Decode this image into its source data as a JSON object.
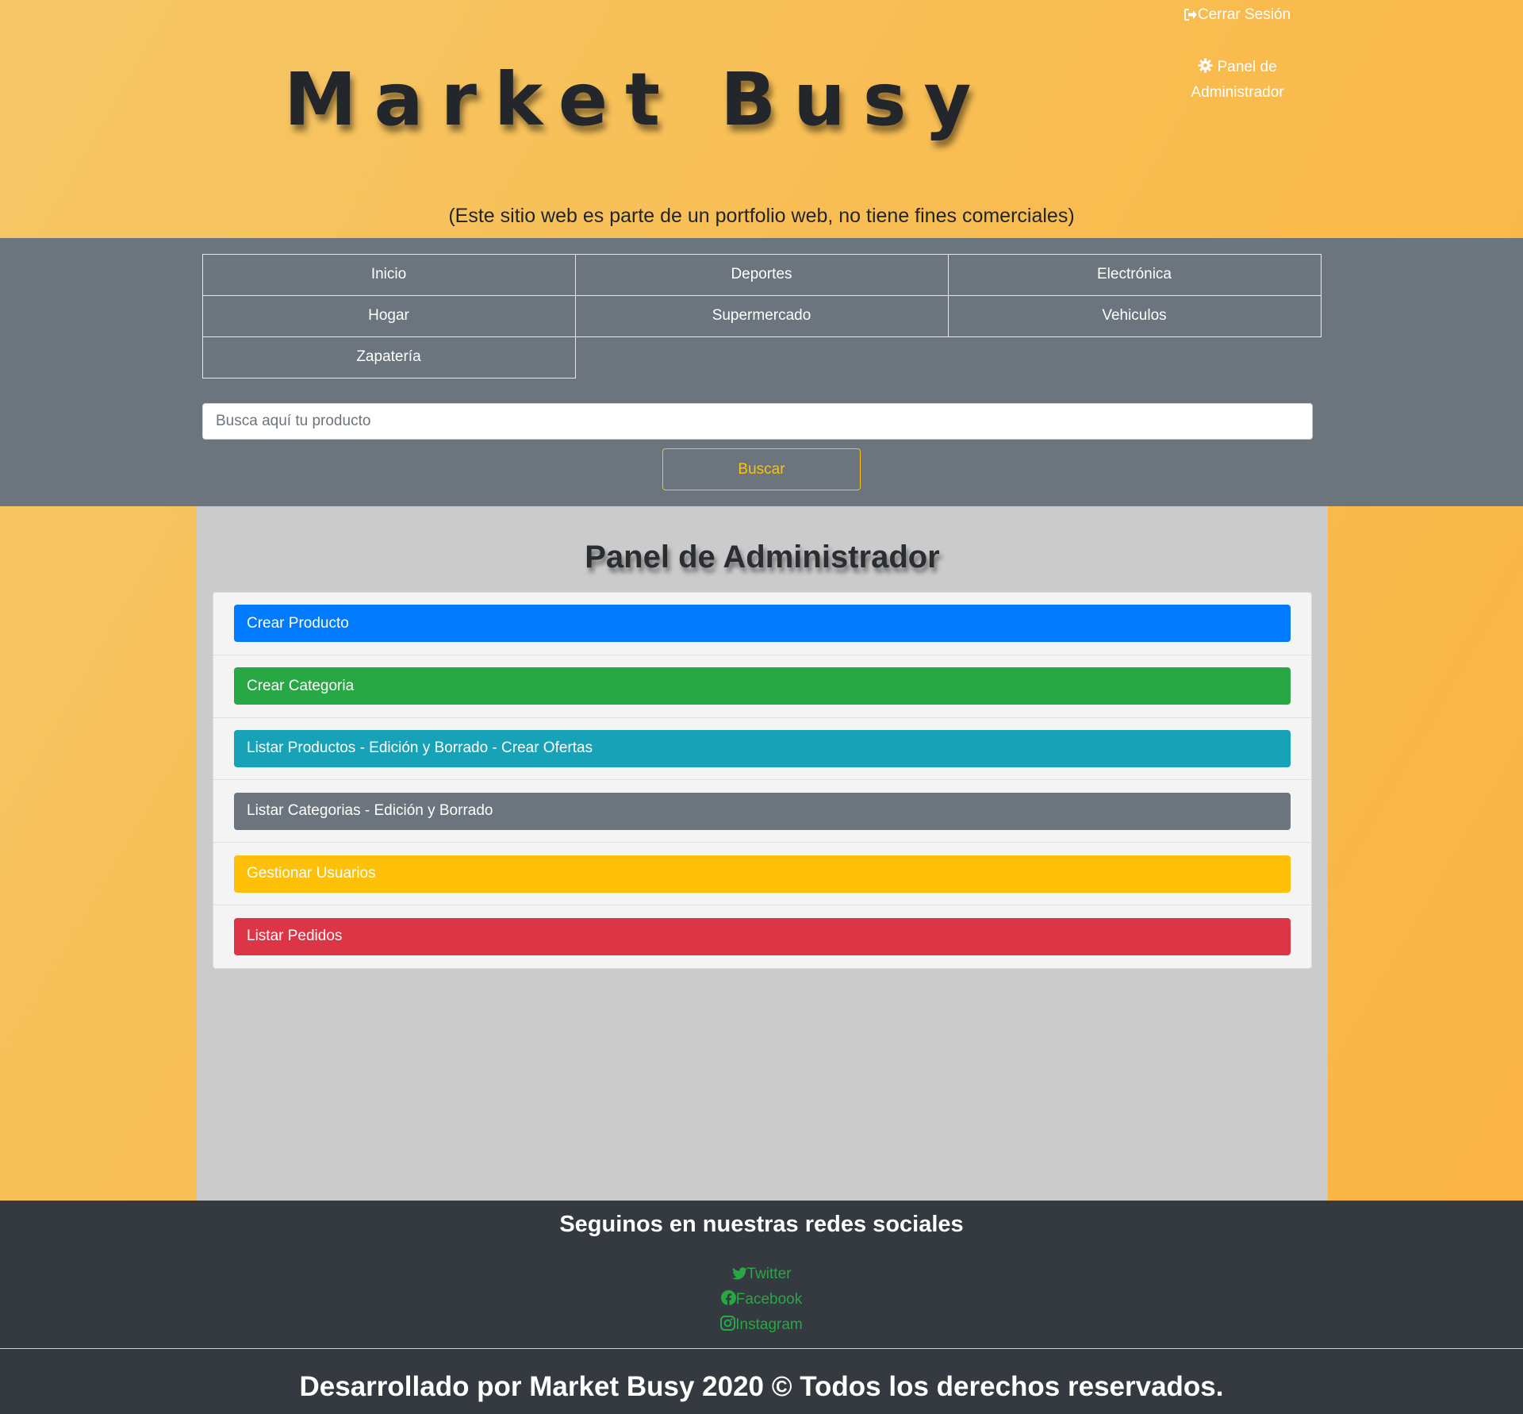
{
  "header": {
    "logo_text": "Market Busy",
    "logout_label": "Cerrar Sesión",
    "admin_panel_label": "Panel de Administrador",
    "subtitle": "(Este sitio web es parte de un portfolio web, no tiene fines comerciales)"
  },
  "nav": {
    "categories": [
      {
        "label": "Inicio"
      },
      {
        "label": "Deportes"
      },
      {
        "label": "Electrónica"
      },
      {
        "label": "Hogar"
      },
      {
        "label": "Supermercado"
      },
      {
        "label": "Vehiculos"
      },
      {
        "label": "Zapatería"
      }
    ]
  },
  "search": {
    "placeholder": "Busca aquí tu producto",
    "value": "",
    "button_label": "Buscar"
  },
  "admin_panel": {
    "title": "Panel de Administrador",
    "actions": [
      {
        "label": "Crear Producto",
        "color": "#007bff"
      },
      {
        "label": "Crear Categoria",
        "color": "#28a745"
      },
      {
        "label": "Listar Productos - Edición y Borrado - Crear Ofertas",
        "color": "#17a2b8"
      },
      {
        "label": "Listar Categorias - Edición y Borrado",
        "color": "#6c757d"
      },
      {
        "label": "Gestionar Usuarios",
        "color": "#ffc107"
      },
      {
        "label": "Listar Pedidos",
        "color": "#dc3545"
      }
    ]
  },
  "footer": {
    "social_title": "Seguinos en nuestras redes sociales",
    "social_links": [
      {
        "label": "Twitter",
        "icon": "twitter-icon"
      },
      {
        "label": "Facebook",
        "icon": "facebook-icon"
      },
      {
        "label": "Instagram",
        "icon": "instagram-icon"
      }
    ],
    "copyright": "Desarrollado por Market Busy 2020 © Todos los derechos reservados."
  },
  "colors": {
    "background_gradient_start": "#f5c766",
    "background_gradient_end": "#fcb443",
    "nav_band": "#6c757d",
    "main_panel": "#cbcbcb",
    "footer": "#343a40",
    "social_link": "#28a745",
    "search_button": "#ffc107"
  }
}
